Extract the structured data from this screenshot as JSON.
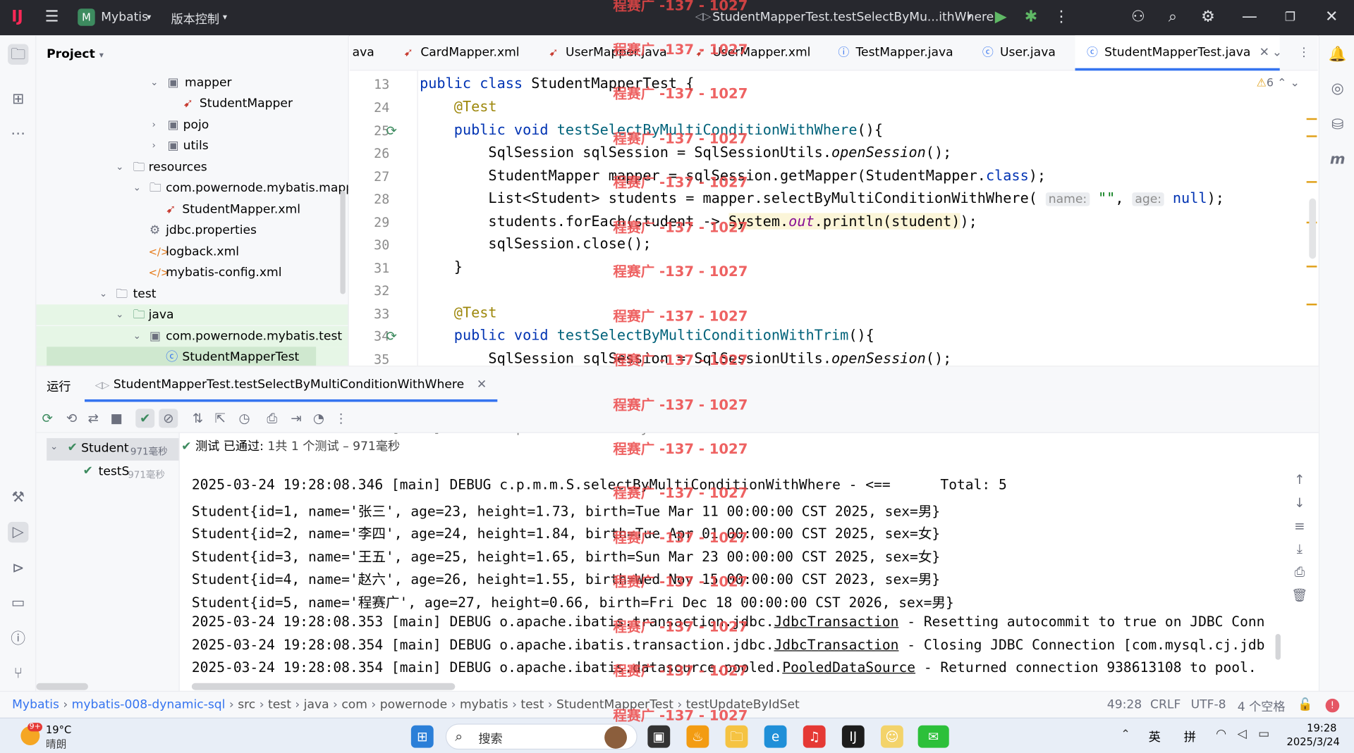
{
  "titlebar": {
    "project_badge": "M",
    "project_name": "Mybatis",
    "vcs_label": "版本控制",
    "run_config": "StudentMapperTest.testSelectByMu...ithWhere"
  },
  "project_panel": {
    "title": "Project",
    "items": [
      {
        "label": "mapper"
      },
      {
        "label": "StudentMapper"
      },
      {
        "label": "pojo"
      },
      {
        "label": "utils"
      },
      {
        "label": "resources"
      },
      {
        "label": "com.powernode.mybatis.mapper"
      },
      {
        "label": "StudentMapper.xml"
      },
      {
        "label": "jdbc.properties"
      },
      {
        "label": "logback.xml"
      },
      {
        "label": "mybatis-config.xml"
      },
      {
        "label": "test"
      },
      {
        "label": "java"
      },
      {
        "label": "com.powernode.mybatis.test"
      },
      {
        "label": "StudentMapperTest"
      }
    ]
  },
  "tabs": [
    {
      "label": "ava"
    },
    {
      "label": "CardMapper.xml"
    },
    {
      "label": "UserMapper.java"
    },
    {
      "label": "UserMapper.xml"
    },
    {
      "label": "TestMapper.java"
    },
    {
      "label": "User.java"
    },
    {
      "label": "StudentMapperTest.java"
    }
  ],
  "editor": {
    "warnings_count": "6",
    "line_numbers": [
      "13",
      "24",
      "25",
      "26",
      "27",
      "28",
      "29",
      "30",
      "31",
      "32",
      "33",
      "34",
      "35"
    ],
    "hint_name": "name:",
    "hint_age": "age:"
  },
  "run_panel": {
    "tab_label": "运行",
    "run_tab_title": "StudentMapperTest.testSelectByMultiConditionWithWhere",
    "tree_root": "Student",
    "tree_root_time": "971毫秒",
    "tree_child": "testS",
    "tree_child_time": "971毫秒",
    "status_prefix": "测试 已通过:",
    "status_detail": "1共 1 个测试 – 971毫秒"
  },
  "console_lines": [
    "2025-03-24 19:28:08.346 [main] DEBUG c.p.m.m.S.selectByMultiConditionWithWhere - <==      Total: 5",
    "Student{id=1, name='张三', age=23, height=1.73, birth=Tue Mar 11 00:00:00 CST 2025, sex=男}",
    "Student{id=2, name='李四', age=24, height=1.84, birth=Tue Apr 01 00:00:00 CST 2025, sex=女}",
    "Student{id=3, name='王五', age=25, height=1.65, birth=Sun Mar 23 00:00:00 CST 2025, sex=女}",
    "Student{id=4, name='赵六', age=26, height=1.55, birth=Wed Nov 15 00:00:00 CST 2023, sex=男}",
    "Student{id=5, name='程赛广', age=27, height=0.66, birth=Fri Dec 18 00:00:00 CST 2026, sex=男}"
  ],
  "console_tx": [
    {
      "prefix": "2025-03-24 19:28:08.353 [main] DEBUG o.apache.ibatis.transaction.jdbc.",
      "link": "JdbcTransaction",
      "suffix": " - Resetting autocommit to true on JDBC Conn"
    },
    {
      "prefix": "2025-03-24 19:28:08.354 [main] DEBUG o.apache.ibatis.transaction.jdbc.",
      "link": "JdbcTransaction",
      "suffix": " - Closing JDBC Connection [com.mysql.cj.jdb"
    },
    {
      "prefix": "2025-03-24 19:28:08.354 [main] DEBUG o.apache.ibatis.datasource.pooled.",
      "link": "PooledDataSource",
      "suffix": " - Returned connection 938613108 to pool."
    }
  ],
  "statusbar": {
    "crumbs": [
      "Mybatis",
      "mybatis-008-dynamic-sql",
      "src",
      "test",
      "java",
      "com",
      "powernode",
      "mybatis",
      "test",
      "StudentMapperTest",
      "testUpdateByIdSet"
    ],
    "position": "49:28",
    "line_sep": "CRLF",
    "encoding": "UTF-8",
    "indent": "4 个空格"
  },
  "taskbar": {
    "weather_badge": "9+",
    "temp": "19°C",
    "condition": "晴朗",
    "search_label": "搜索",
    "ime1": "英",
    "ime2": "拼",
    "time": "19:28",
    "date": "2025/3/24"
  },
  "watermark": "程赛广 -137 - 1027",
  "colors": {
    "accent": "#3574f0",
    "success": "#3d8b5f",
    "warning": "#e0a018",
    "watermark": "#eb4646"
  }
}
